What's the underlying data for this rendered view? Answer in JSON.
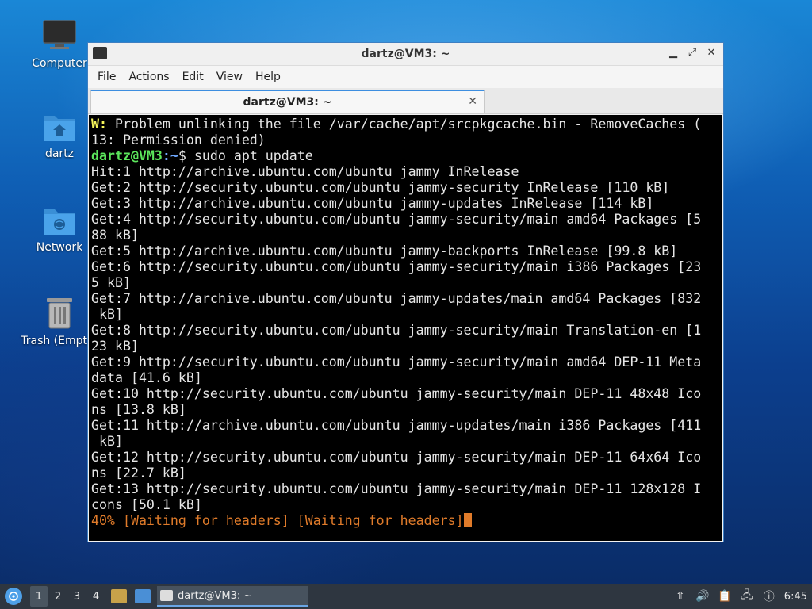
{
  "desktop": {
    "icons": [
      {
        "label": "Computer"
      },
      {
        "label": "dartz"
      },
      {
        "label": "Network"
      },
      {
        "label": "Trash (Empty)"
      }
    ]
  },
  "window": {
    "title": "dartz@VM3: ~",
    "controls": {
      "minimize": "▁",
      "maximize": "⤢",
      "close": "✕"
    },
    "menu": [
      "File",
      "Actions",
      "Edit",
      "View",
      "Help"
    ],
    "tab": {
      "label": "dartz@VM3: ~",
      "close": "✕"
    }
  },
  "terminal": {
    "warning": {
      "prefix": "W:",
      "text1": " Problem unlinking the file /var/cache/apt/srcpkgcache.bin - RemoveCaches (",
      "text2": "13: Permission denied)"
    },
    "prompt": {
      "user": "dartz@VM3",
      "path": ":~",
      "symbol": "$ ",
      "command": "sudo apt update"
    },
    "output": [
      "Hit:1 http://archive.ubuntu.com/ubuntu jammy InRelease",
      "Get:2 http://security.ubuntu.com/ubuntu jammy-security InRelease [110 kB]",
      "Get:3 http://archive.ubuntu.com/ubuntu jammy-updates InRelease [114 kB]",
      "Get:4 http://security.ubuntu.com/ubuntu jammy-security/main amd64 Packages [5",
      "88 kB]",
      "Get:5 http://archive.ubuntu.com/ubuntu jammy-backports InRelease [99.8 kB]",
      "Get:6 http://security.ubuntu.com/ubuntu jammy-security/main i386 Packages [23",
      "5 kB]",
      "Get:7 http://archive.ubuntu.com/ubuntu jammy-updates/main amd64 Packages [832",
      " kB]",
      "Get:8 http://security.ubuntu.com/ubuntu jammy-security/main Translation-en [1",
      "23 kB]",
      "Get:9 http://security.ubuntu.com/ubuntu jammy-security/main amd64 DEP-11 Meta",
      "data [41.6 kB]",
      "Get:10 http://security.ubuntu.com/ubuntu jammy-security/main DEP-11 48x48 Ico",
      "ns [13.8 kB]",
      "Get:11 http://archive.ubuntu.com/ubuntu jammy-updates/main i386 Packages [411",
      " kB]",
      "Get:12 http://security.ubuntu.com/ubuntu jammy-security/main DEP-11 64x64 Ico",
      "ns [22.7 kB]",
      "Get:13 http://security.ubuntu.com/ubuntu jammy-security/main DEP-11 128x128 I",
      "cons [50.1 kB]"
    ],
    "progress": "40% [Waiting for headers] [Waiting for headers]"
  },
  "taskbar": {
    "workspaces": [
      "1",
      "2",
      "3",
      "4"
    ],
    "active_workspace": "1",
    "task": {
      "label": "dartz@VM3: ~"
    },
    "clock": "6:45"
  },
  "colors": {
    "warning": "#f4f45a",
    "prompt_user": "#5ce65c",
    "prompt_path": "#6fa8ff",
    "progress": "#e07b2a"
  }
}
